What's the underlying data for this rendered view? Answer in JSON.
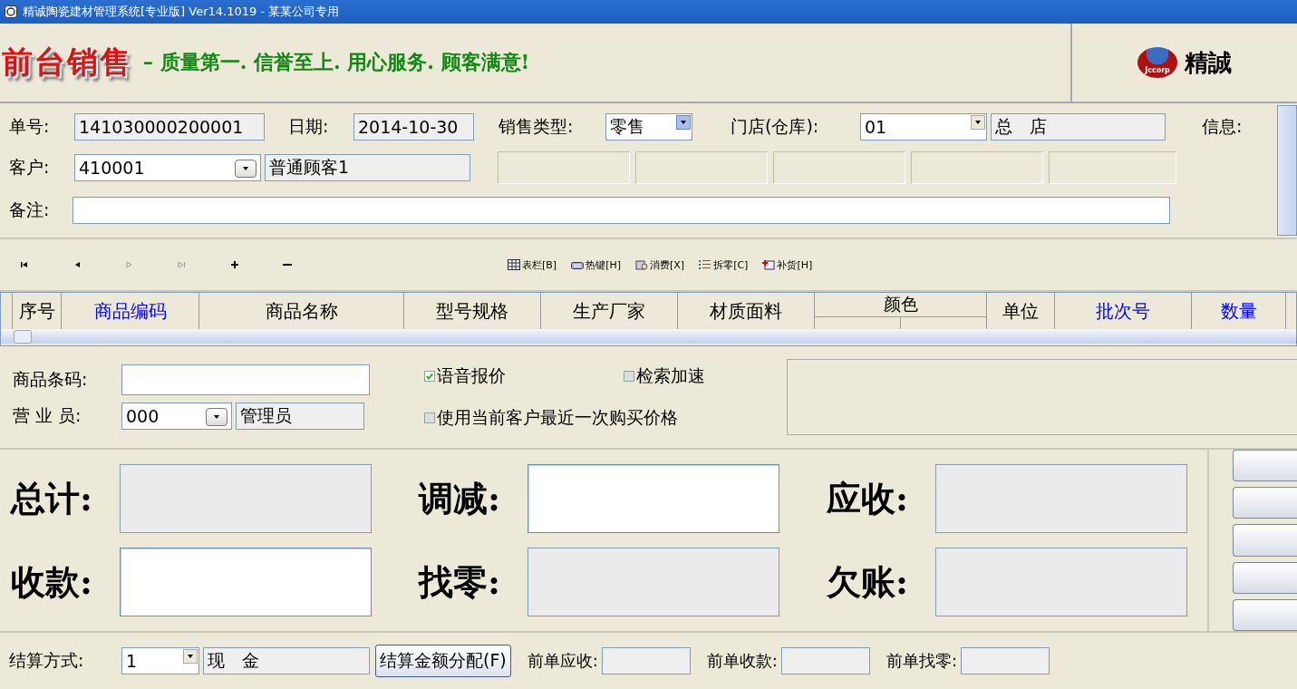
{
  "window": {
    "title": "精诚陶瓷建材管理系统[专业版] Ver14.1019  -  某某公司专用"
  },
  "banner": {
    "title": "前台销售",
    "slogan": "– 质量第一. 信誉至上. 用心服务. 顾客满意!",
    "logo_mark": "Jccorp",
    "logo_name": "精誠"
  },
  "header_form": {
    "order_no": {
      "label": "单号:",
      "value": "141030000200001"
    },
    "date": {
      "label": "日期:",
      "value": "2014-10-30"
    },
    "sale_type": {
      "label": "销售类型:",
      "value": "零售"
    },
    "store": {
      "label": "门店(仓库):",
      "code": "01",
      "name": "总　店"
    },
    "info": {
      "label": "信息:"
    },
    "customer": {
      "label": "客户:",
      "code": "410001",
      "name": "普通顾客1"
    },
    "note": {
      "label": "备注:"
    }
  },
  "toolbar": {
    "nav_buttons": [
      {
        "kind": "first",
        "disabled": false
      },
      {
        "kind": "prev",
        "disabled": false
      },
      {
        "kind": "next",
        "disabled": true
      },
      {
        "kind": "last",
        "disabled": true
      },
      {
        "kind": "add",
        "disabled": false
      },
      {
        "kind": "remove",
        "disabled": false
      }
    ],
    "tools": [
      {
        "kind": "table",
        "label": "表栏[B]"
      },
      {
        "kind": "keyboard",
        "label": "热键[H]"
      },
      {
        "kind": "consume",
        "label": "消费[X]"
      },
      {
        "kind": "split",
        "label": "拆零[C]"
      },
      {
        "kind": "restock",
        "label": "补货[H]"
      }
    ]
  },
  "grid": {
    "columns": [
      {
        "label": "序号",
        "color": "#000000"
      },
      {
        "label": "商品编码",
        "color": "#0000ff"
      },
      {
        "label": "商品名称",
        "color": "#000000"
      },
      {
        "label": "型号规格",
        "color": "#000000"
      },
      {
        "label": "生产厂家",
        "color": "#000000"
      },
      {
        "label": "材质面料",
        "color": "#000000"
      },
      {
        "label": "颜色",
        "color": "#000000",
        "group": true
      },
      {
        "label": "单位",
        "color": "#000000"
      },
      {
        "label": "批次号",
        "color": "#0000ff"
      },
      {
        "label": "数量",
        "color": "#0000ff"
      }
    ]
  },
  "entry": {
    "barcode": {
      "label": "商品条码:"
    },
    "clerk": {
      "label": "营 业 员:",
      "code": "000",
      "name": "管理员"
    },
    "options": [
      {
        "label": "语音报价",
        "checked": true
      },
      {
        "label": "检索加速",
        "checked": false
      },
      {
        "label": "使用当前客户最近一次购买价格",
        "checked": false
      }
    ]
  },
  "totals": [
    {
      "label": "总计:",
      "editable": false
    },
    {
      "label": "调减:",
      "editable": true
    },
    {
      "label": "应收:",
      "editable": false
    },
    {
      "label": "收款:",
      "editable": true
    },
    {
      "label": "找零:",
      "editable": false
    },
    {
      "label": "欠账:",
      "editable": false
    }
  ],
  "footer": {
    "settlement": {
      "label": "结算方式:",
      "code": "1",
      "name": "现　金"
    },
    "allocate_button": "结算金额分配(F)",
    "previous": [
      {
        "label": "前单应收:"
      },
      {
        "label": "前单收款:"
      },
      {
        "label": "前单找零:"
      }
    ]
  }
}
